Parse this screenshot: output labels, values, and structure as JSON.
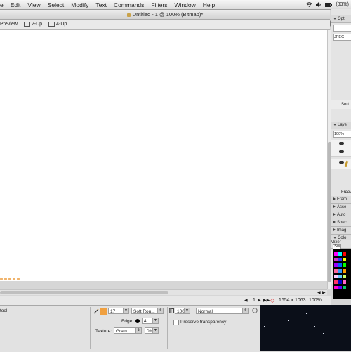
{
  "menubar": {
    "items": [
      "e",
      "Edit",
      "View",
      "Select",
      "Modify",
      "Text",
      "Commands",
      "Filters",
      "Window",
      "Help"
    ],
    "battery": "(83%)"
  },
  "document": {
    "title": "Untitled - 1 @ 100% (Bitmap)*"
  },
  "viewtabs": {
    "preview": "Preview",
    "two_up": "2-Up",
    "four_up": "4-Up"
  },
  "statusbar": {
    "page": "1",
    "dimensions": "1654 x 1063",
    "zoom": "100%"
  },
  "properties": {
    "tool_label": "tool",
    "brush_size": "17",
    "brush_type": "Soft Rou...",
    "edge_label": "Edge:",
    "edge_value": "4",
    "texture_label": "Texture:",
    "texture_value": "Grain",
    "texture_amount": "0%",
    "opacity": "100",
    "blend_mode": "Normal",
    "preserve_transparency": "Preserve transparency"
  },
  "right_panel": {
    "optimize_title": "Opti",
    "format": "JPEG",
    "sort_label": "Sort",
    "layers_title": "Laye",
    "layers_opacity": "100%",
    "freeform_label": "Freew",
    "collapsed_panels": [
      "Fram",
      "Asse",
      "Auto",
      "Spec",
      "Imag"
    ],
    "colors_title": "Colo",
    "mixer_label": "Mixer",
    "swatches_label": "Sw"
  },
  "colors": {
    "accent_orange": "#f0a040",
    "canvas_bg": "#ffffff",
    "preview_bg": "#0b0f19"
  }
}
